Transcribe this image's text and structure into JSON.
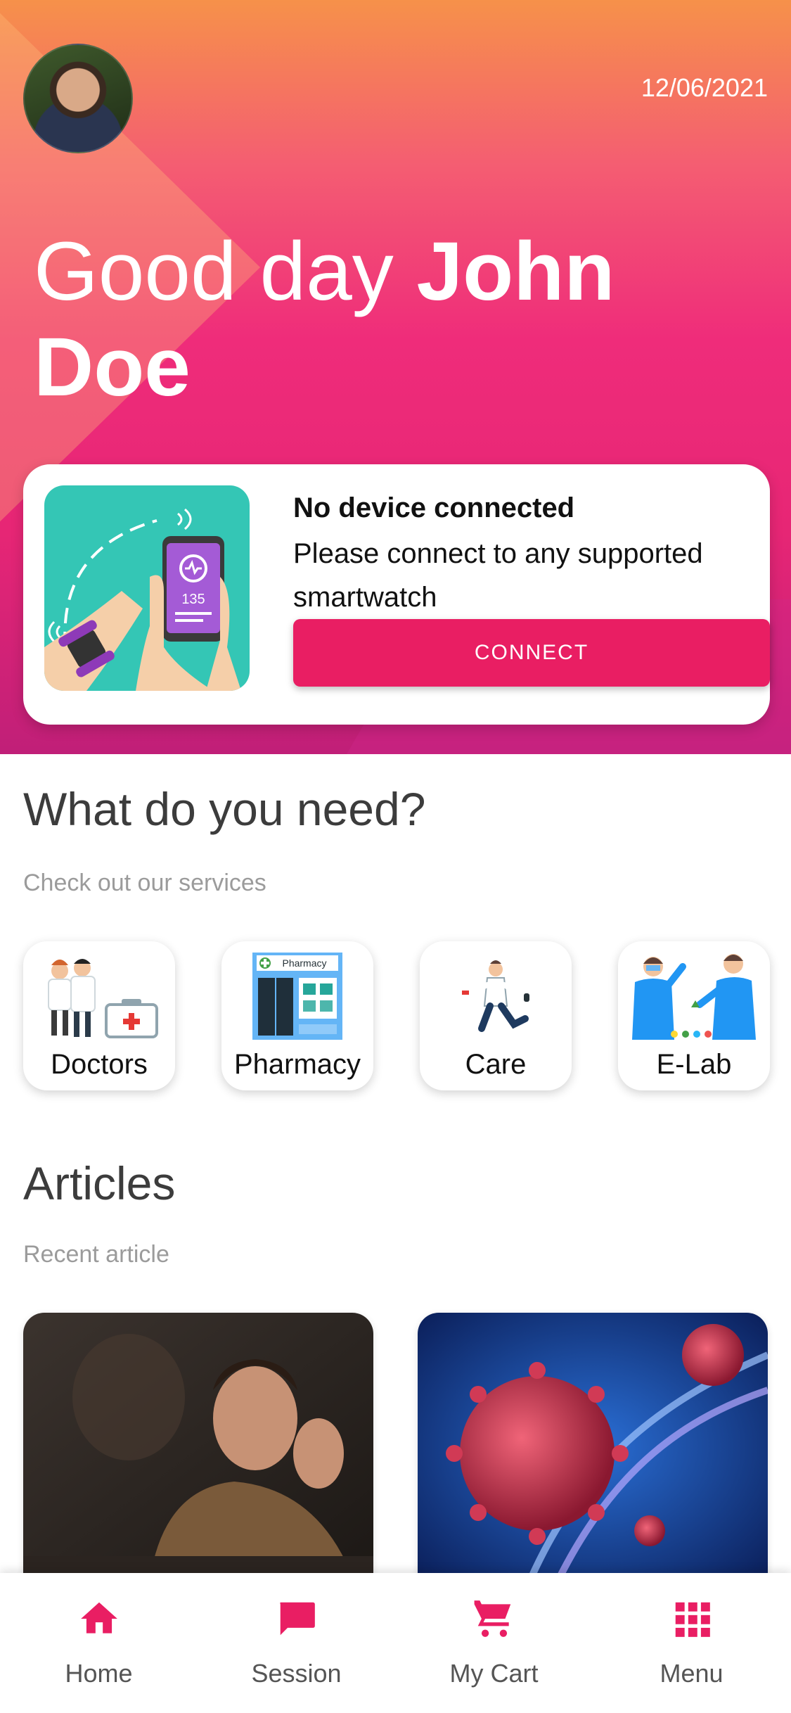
{
  "header": {
    "date": "12/06/2021",
    "greeting_prefix": "Good day ",
    "user_name": "John Doe"
  },
  "device_card": {
    "title": "No device connected",
    "description": "Please connect to any supported smartwatch",
    "connect_label": "CONNECT",
    "heart_rate": "135"
  },
  "services_section": {
    "title": "What do you need?",
    "subtitle": "Check out our services",
    "items": [
      {
        "label": "Doctors"
      },
      {
        "label": "Pharmacy",
        "sign": "Pharmacy"
      },
      {
        "label": "Care"
      },
      {
        "label": "E-Lab"
      }
    ]
  },
  "articles_section": {
    "title": "Articles",
    "subtitle": "Recent article"
  },
  "bottom_nav": {
    "items": [
      {
        "label": "Home",
        "icon": "home-icon"
      },
      {
        "label": "Session",
        "icon": "chat-icon"
      },
      {
        "label": "My Cart",
        "icon": "cart-icon"
      },
      {
        "label": "Menu",
        "icon": "grid-icon"
      }
    ]
  },
  "colors": {
    "accent": "#e91e63",
    "hero_top": "#f6914a",
    "hero_bottom": "#c01f78",
    "device_illustration_bg": "#34c6b5"
  }
}
